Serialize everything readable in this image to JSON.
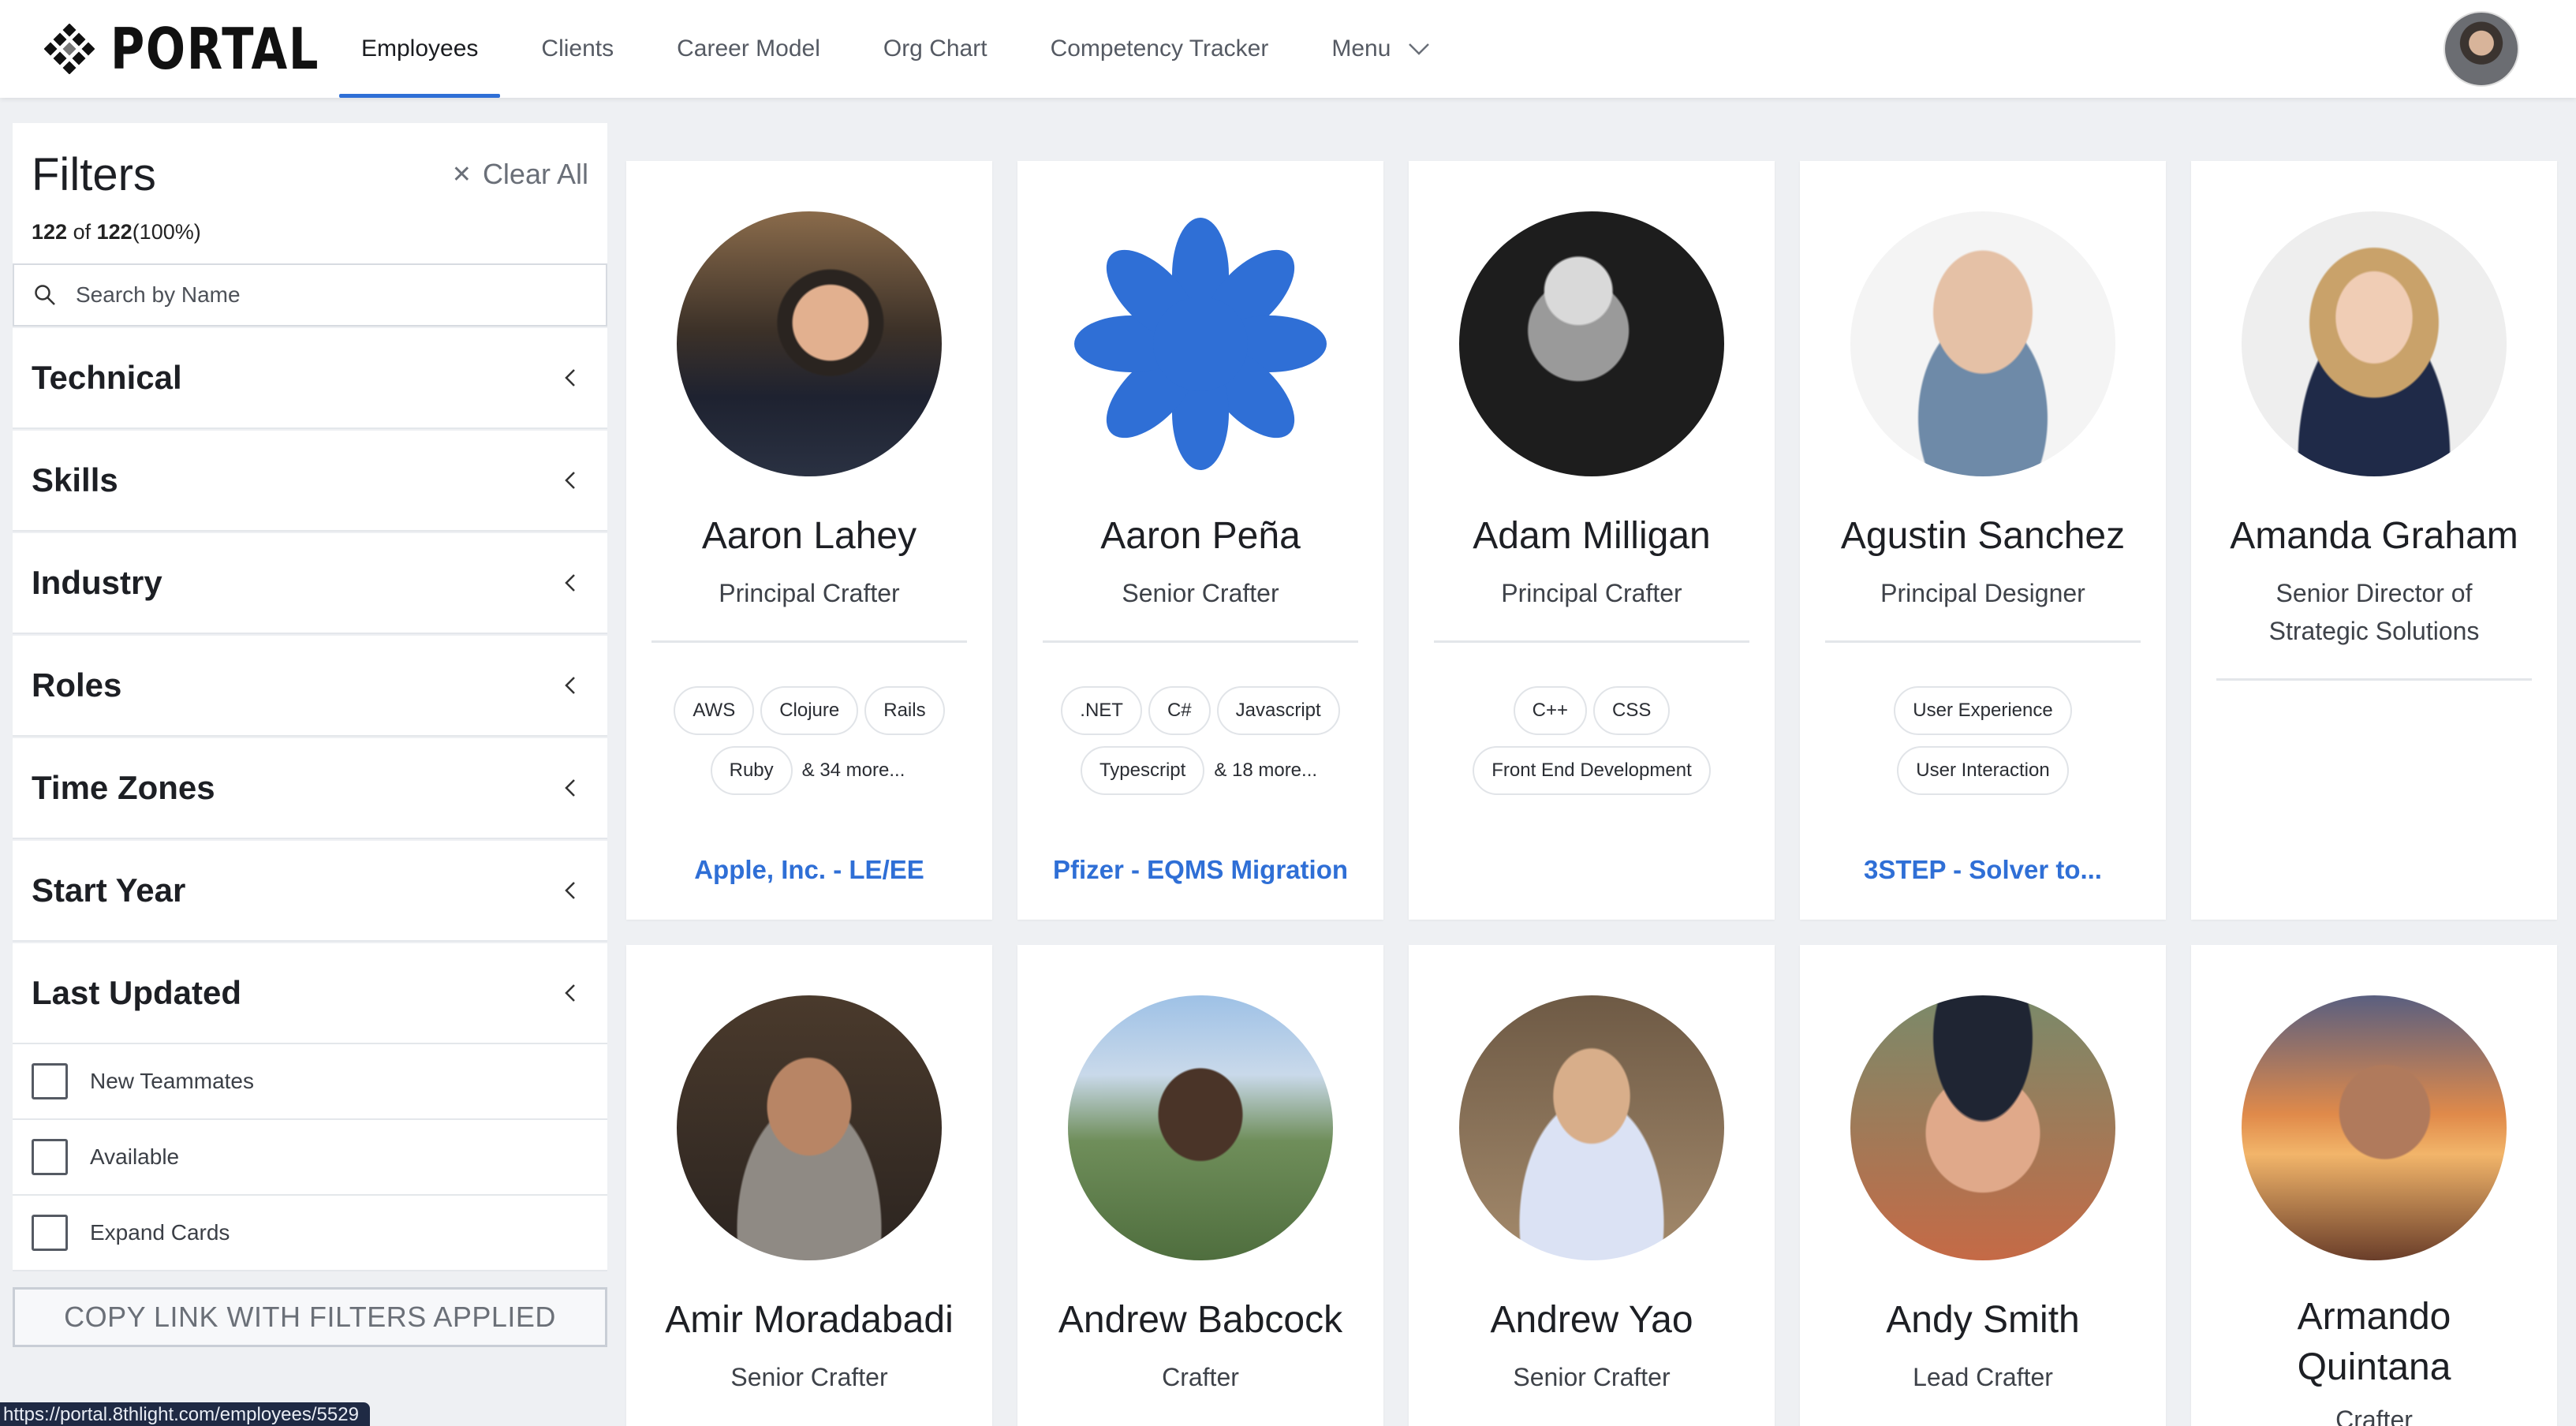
{
  "brand": {
    "name": "PORTAL"
  },
  "nav": {
    "items": [
      {
        "label": "Employees",
        "active": true
      },
      {
        "label": "Clients"
      },
      {
        "label": "Career Model"
      },
      {
        "label": "Org Chart"
      },
      {
        "label": "Competency Tracker"
      },
      {
        "label": "Menu"
      }
    ]
  },
  "filters": {
    "title": "Filters",
    "count_shown": "122",
    "count_of": "of",
    "count_total": "122",
    "count_percent": "(100%)",
    "clear_all": "Clear All",
    "search_placeholder": "Search by Name",
    "facets": [
      "Technical",
      "Skills",
      "Industry",
      "Roles",
      "Time Zones",
      "Start Year",
      "Last Updated"
    ],
    "checks": [
      "New Teammates",
      "Available",
      "Expand Cards"
    ],
    "copy_link": "COPY LINK WITH FILTERS APPLIED"
  },
  "status_url": "https://portal.8thlight.com/employees/5529",
  "cards": [
    {
      "name": "Aaron Lahey",
      "title": "Principal Crafter",
      "tags": [
        "AWS",
        "Clojure",
        "Rails",
        "Ruby"
      ],
      "more": "& 34 more...",
      "project": "Apple, Inc. - LE/EE"
    },
    {
      "name": "Aaron Peña",
      "title": "Senior Crafter",
      "tags": [
        ".NET",
        "C#",
        "Javascript",
        "Typescript"
      ],
      "more": "& 18 more...",
      "project": "Pfizer - EQMS Migration"
    },
    {
      "name": "Adam Milligan",
      "title": "Principal Crafter",
      "tags": [
        "C++",
        "CSS",
        "Front End Development"
      ],
      "more": "",
      "project": ""
    },
    {
      "name": "Agustin Sanchez",
      "title": "Principal Designer",
      "tags": [
        "User Experience",
        "User Interaction"
      ],
      "more": "",
      "project": "3STEP - Solver to..."
    },
    {
      "name": "Amanda Graham",
      "title": "Senior Director of Strategic Solutions",
      "tags": [],
      "more": "",
      "project": ""
    },
    {
      "name": "Amir Moradabadi",
      "title": "Senior Crafter"
    },
    {
      "name": "Andrew Babcock",
      "title": "Crafter"
    },
    {
      "name": "Andrew Yao",
      "title": "Senior Crafter"
    },
    {
      "name": "Andy Smith",
      "title": "Lead Crafter"
    },
    {
      "name": "Armando Quintana",
      "title": "Crafter"
    }
  ]
}
